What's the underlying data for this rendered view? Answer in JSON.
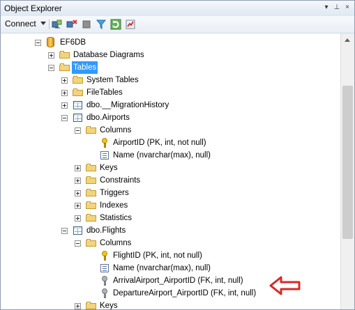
{
  "window": {
    "title": "Object Explorer",
    "pin_icon": "pin-icon",
    "close_icon": "close-icon"
  },
  "toolbar": {
    "connect": "Connect"
  },
  "tree": [
    {
      "label": "EF6DB",
      "level": 0,
      "icon": "database",
      "expanded": true
    },
    {
      "label": "Database Diagrams",
      "level": 1,
      "icon": "folder",
      "expanded": false
    },
    {
      "label": "Tables",
      "level": 1,
      "icon": "folder",
      "expanded": true,
      "selected": true
    },
    {
      "label": "System Tables",
      "level": 2,
      "icon": "folder",
      "expanded": false
    },
    {
      "label": "FileTables",
      "level": 2,
      "icon": "folder",
      "expanded": false
    },
    {
      "label": "dbo.__MigrationHistory",
      "level": 2,
      "icon": "table",
      "expanded": false
    },
    {
      "label": "dbo.Airports",
      "level": 2,
      "icon": "table",
      "expanded": true
    },
    {
      "label": "Columns",
      "level": 3,
      "icon": "folder",
      "expanded": true
    },
    {
      "label": "AirportID (PK, int, not null)",
      "level": 4,
      "icon": "key"
    },
    {
      "label": "Name (nvarchar(max), null)",
      "level": 4,
      "icon": "column"
    },
    {
      "label": "Keys",
      "level": 3,
      "icon": "folder",
      "expanded": false
    },
    {
      "label": "Constraints",
      "level": 3,
      "icon": "folder",
      "expanded": false
    },
    {
      "label": "Triggers",
      "level": 3,
      "icon": "folder",
      "expanded": false
    },
    {
      "label": "Indexes",
      "level": 3,
      "icon": "folder",
      "expanded": false
    },
    {
      "label": "Statistics",
      "level": 3,
      "icon": "folder",
      "expanded": false
    },
    {
      "label": "dbo.Flights",
      "level": 2,
      "icon": "table",
      "expanded": true
    },
    {
      "label": "Columns",
      "level": 3,
      "icon": "folder",
      "expanded": true
    },
    {
      "label": "FlightID (PK, int, not null)",
      "level": 4,
      "icon": "key"
    },
    {
      "label": "Name (nvarchar(max), null)",
      "level": 4,
      "icon": "column"
    },
    {
      "label": "ArrivalAirport_AirportID (FK, int, null)",
      "level": 4,
      "icon": "foreign-key"
    },
    {
      "label": "DepartureAirport_AirportID (FK, int, null)",
      "level": 4,
      "icon": "foreign-key"
    },
    {
      "label": "Keys",
      "level": 3,
      "icon": "folder",
      "expanded": false
    }
  ],
  "annotation": {
    "color": "#d72828",
    "icon": "red-arrow-icon"
  }
}
